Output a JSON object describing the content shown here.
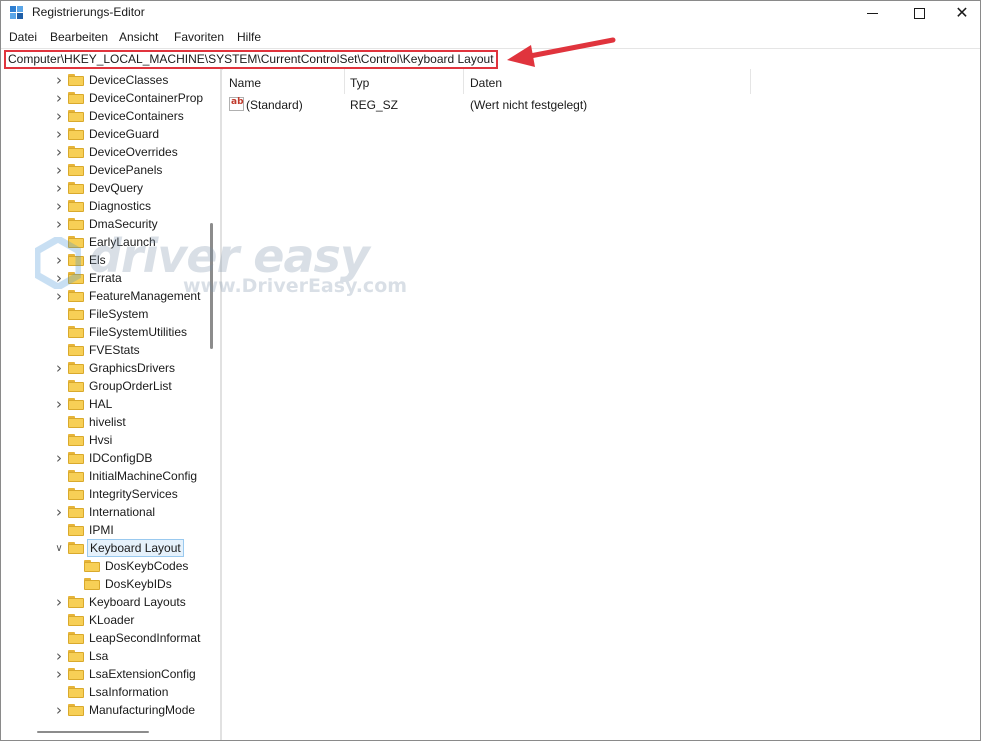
{
  "window": {
    "title": "Registrierungs-Editor",
    "controls": {
      "minimize": "minimize",
      "maximize": "maximize",
      "close": "✕"
    }
  },
  "menu": [
    "Datei",
    "Bearbeiten",
    "Ansicht",
    "Favoriten",
    "Hilfe"
  ],
  "address": {
    "path": "Computer\\HKEY_LOCAL_MACHINE\\SYSTEM\\CurrentControlSet\\Control\\Keyboard Layout",
    "highlight_color": "#e0343d"
  },
  "tree": {
    "items": [
      {
        "label": "DeviceClasses",
        "expander": "collapsed"
      },
      {
        "label": "DeviceContainerProp",
        "expander": "collapsed"
      },
      {
        "label": "DeviceContainers",
        "expander": "collapsed"
      },
      {
        "label": "DeviceGuard",
        "expander": "collapsed"
      },
      {
        "label": "DeviceOverrides",
        "expander": "collapsed"
      },
      {
        "label": "DevicePanels",
        "expander": "collapsed"
      },
      {
        "label": "DevQuery",
        "expander": "collapsed"
      },
      {
        "label": "Diagnostics",
        "expander": "collapsed"
      },
      {
        "label": "DmaSecurity",
        "expander": "collapsed"
      },
      {
        "label": "EarlyLaunch",
        "expander": "none"
      },
      {
        "label": "Els",
        "expander": "collapsed"
      },
      {
        "label": "Errata",
        "expander": "collapsed"
      },
      {
        "label": "FeatureManagement",
        "expander": "collapsed"
      },
      {
        "label": "FileSystem",
        "expander": "none"
      },
      {
        "label": "FileSystemUtilities",
        "expander": "none"
      },
      {
        "label": "FVEStats",
        "expander": "none"
      },
      {
        "label": "GraphicsDrivers",
        "expander": "collapsed"
      },
      {
        "label": "GroupOrderList",
        "expander": "none"
      },
      {
        "label": "HAL",
        "expander": "collapsed"
      },
      {
        "label": "hivelist",
        "expander": "none"
      },
      {
        "label": "Hvsi",
        "expander": "none"
      },
      {
        "label": "IDConfigDB",
        "expander": "collapsed"
      },
      {
        "label": "InitialMachineConfig",
        "expander": "none"
      },
      {
        "label": "IntegrityServices",
        "expander": "none"
      },
      {
        "label": "International",
        "expander": "collapsed"
      },
      {
        "label": "IPMI",
        "expander": "none"
      },
      {
        "label": "Keyboard Layout",
        "expander": "expanded",
        "selected": true
      },
      {
        "label": "DosKeybCodes",
        "expander": "none",
        "child": true
      },
      {
        "label": "DosKeybIDs",
        "expander": "none",
        "child": true
      },
      {
        "label": "Keyboard Layouts",
        "expander": "collapsed"
      },
      {
        "label": "KLoader",
        "expander": "none"
      },
      {
        "label": "LeapSecondInformat",
        "expander": "none"
      },
      {
        "label": "Lsa",
        "expander": "collapsed"
      },
      {
        "label": "LsaExtensionConfig",
        "expander": "collapsed"
      },
      {
        "label": "LsaInformation",
        "expander": "none"
      },
      {
        "label": "ManufacturingMode",
        "expander": "collapsed"
      }
    ]
  },
  "list": {
    "columns": [
      "Name",
      "Typ",
      "Daten"
    ],
    "rows": [
      {
        "icon": "string-value-icon",
        "icon_text": "ab",
        "name": "(Standard)",
        "type": "REG_SZ",
        "data": "(Wert nicht festgelegt)"
      }
    ]
  },
  "watermark": {
    "brand": "driver easy",
    "url": "www.DriverEasy.com"
  },
  "colors": {
    "folder": "#f7cf56",
    "selection_bg": "#e5f1fb",
    "selection_border": "#99c9ef",
    "arrow": "#e0343d"
  }
}
